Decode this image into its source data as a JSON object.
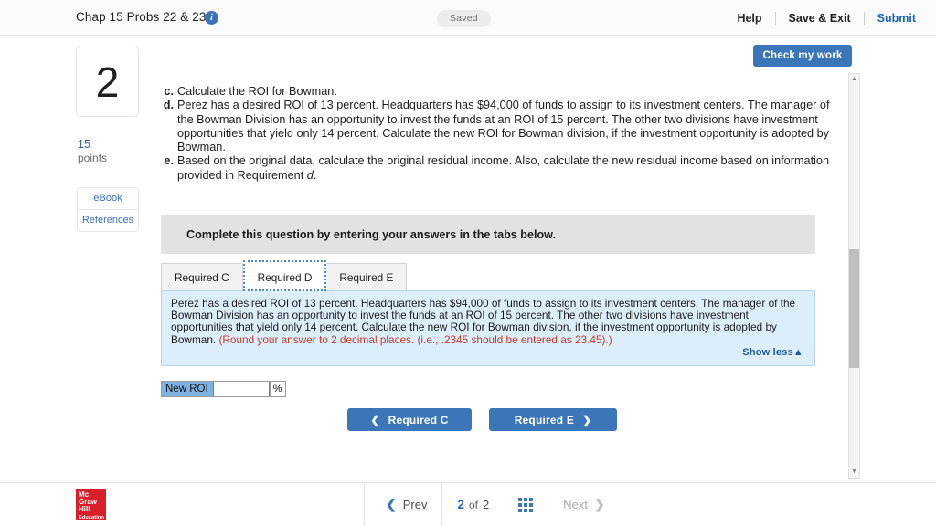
{
  "header": {
    "assignment_title": "Chap 15 Probs 22 & 23",
    "info_icon": "info-icon",
    "saved_badge": "Saved",
    "help_label": "Help",
    "save_exit_label": "Save & Exit",
    "submit_label": "Submit"
  },
  "toolbar": {
    "check_my_work_label": "Check my work"
  },
  "left_rail": {
    "question_number": "2",
    "points_value": "15",
    "points_label": "points",
    "ebook_label": "eBook",
    "references_label": "References"
  },
  "requirements": [
    {
      "letter": "c.",
      "text": "Calculate the ROI for Bowman."
    },
    {
      "letter": "d.",
      "text": "Perez has a desired ROI of 13 percent. Headquarters has $94,000 of funds to assign to its investment centers. The manager of the Bowman Division has an opportunity to invest the funds at an ROI of 15 percent. The other two divisions have investment opportunities that yield only 14 percent. Calculate the new ROI for Bowman division, if the investment opportunity is adopted by Bowman."
    },
    {
      "letter": "e.",
      "text_pre": "Based on the original data, calculate the original residual income. Also, calculate the new residual income based on information provided in Requirement ",
      "text_em": "d",
      "text_post": "."
    }
  ],
  "instruction_banner": {
    "text": "Complete this question by entering your answers in the tabs below."
  },
  "tabs": [
    {
      "label": "Required C",
      "active": false
    },
    {
      "label": "Required D",
      "active": true
    },
    {
      "label": "Required E",
      "active": false
    }
  ],
  "blue_panel": {
    "body": "Perez has a desired ROI of 13 percent. Headquarters has $94,000 of funds to assign to its investment centers. The manager of the Bowman Division has an opportunity to invest the funds at an ROI of 15 percent. The other two divisions have investment opportunities that yield only 14 percent. Calculate the new ROI for Bowman division, if the investment opportunity is adopted by Bowman. ",
    "round_note": "(Round your answer to 2 decimal places. (i.e., .2345 should be entered as 23.45).)",
    "show_less_label": "Show less",
    "show_less_icon": "triangle-up-icon"
  },
  "answer_row": {
    "label": "New ROI",
    "input_value": "",
    "input_placeholder": "",
    "unit": "%"
  },
  "nav_buttons": {
    "prev_label": "Required C",
    "prev_icon": "chevron-left-icon",
    "next_label": "Required E",
    "next_icon": "chevron-right-icon"
  },
  "scrollbar": {
    "up_icon": "triangle-up-icon",
    "down_icon": "triangle-down-icon"
  },
  "footer": {
    "logo": {
      "line1": "Mc",
      "line2": "Graw",
      "line3": "Hill",
      "line4": "Education"
    },
    "prev_label": "Prev",
    "prev_icon": "chevron-left-icon",
    "current_page": "2",
    "of_label": "of",
    "total_pages": "2",
    "grid_icon": "grid-view-icon",
    "next_label": "Next",
    "next_icon": "chevron-right-icon"
  },
  "colors": {
    "accent_blue": "#3a76b8",
    "link_blue": "#1866b7",
    "panel_blue": "#ddeefb",
    "label_blue": "#7eb2e2",
    "red_note": "#c0392b",
    "logo_red": "#d8202a"
  }
}
